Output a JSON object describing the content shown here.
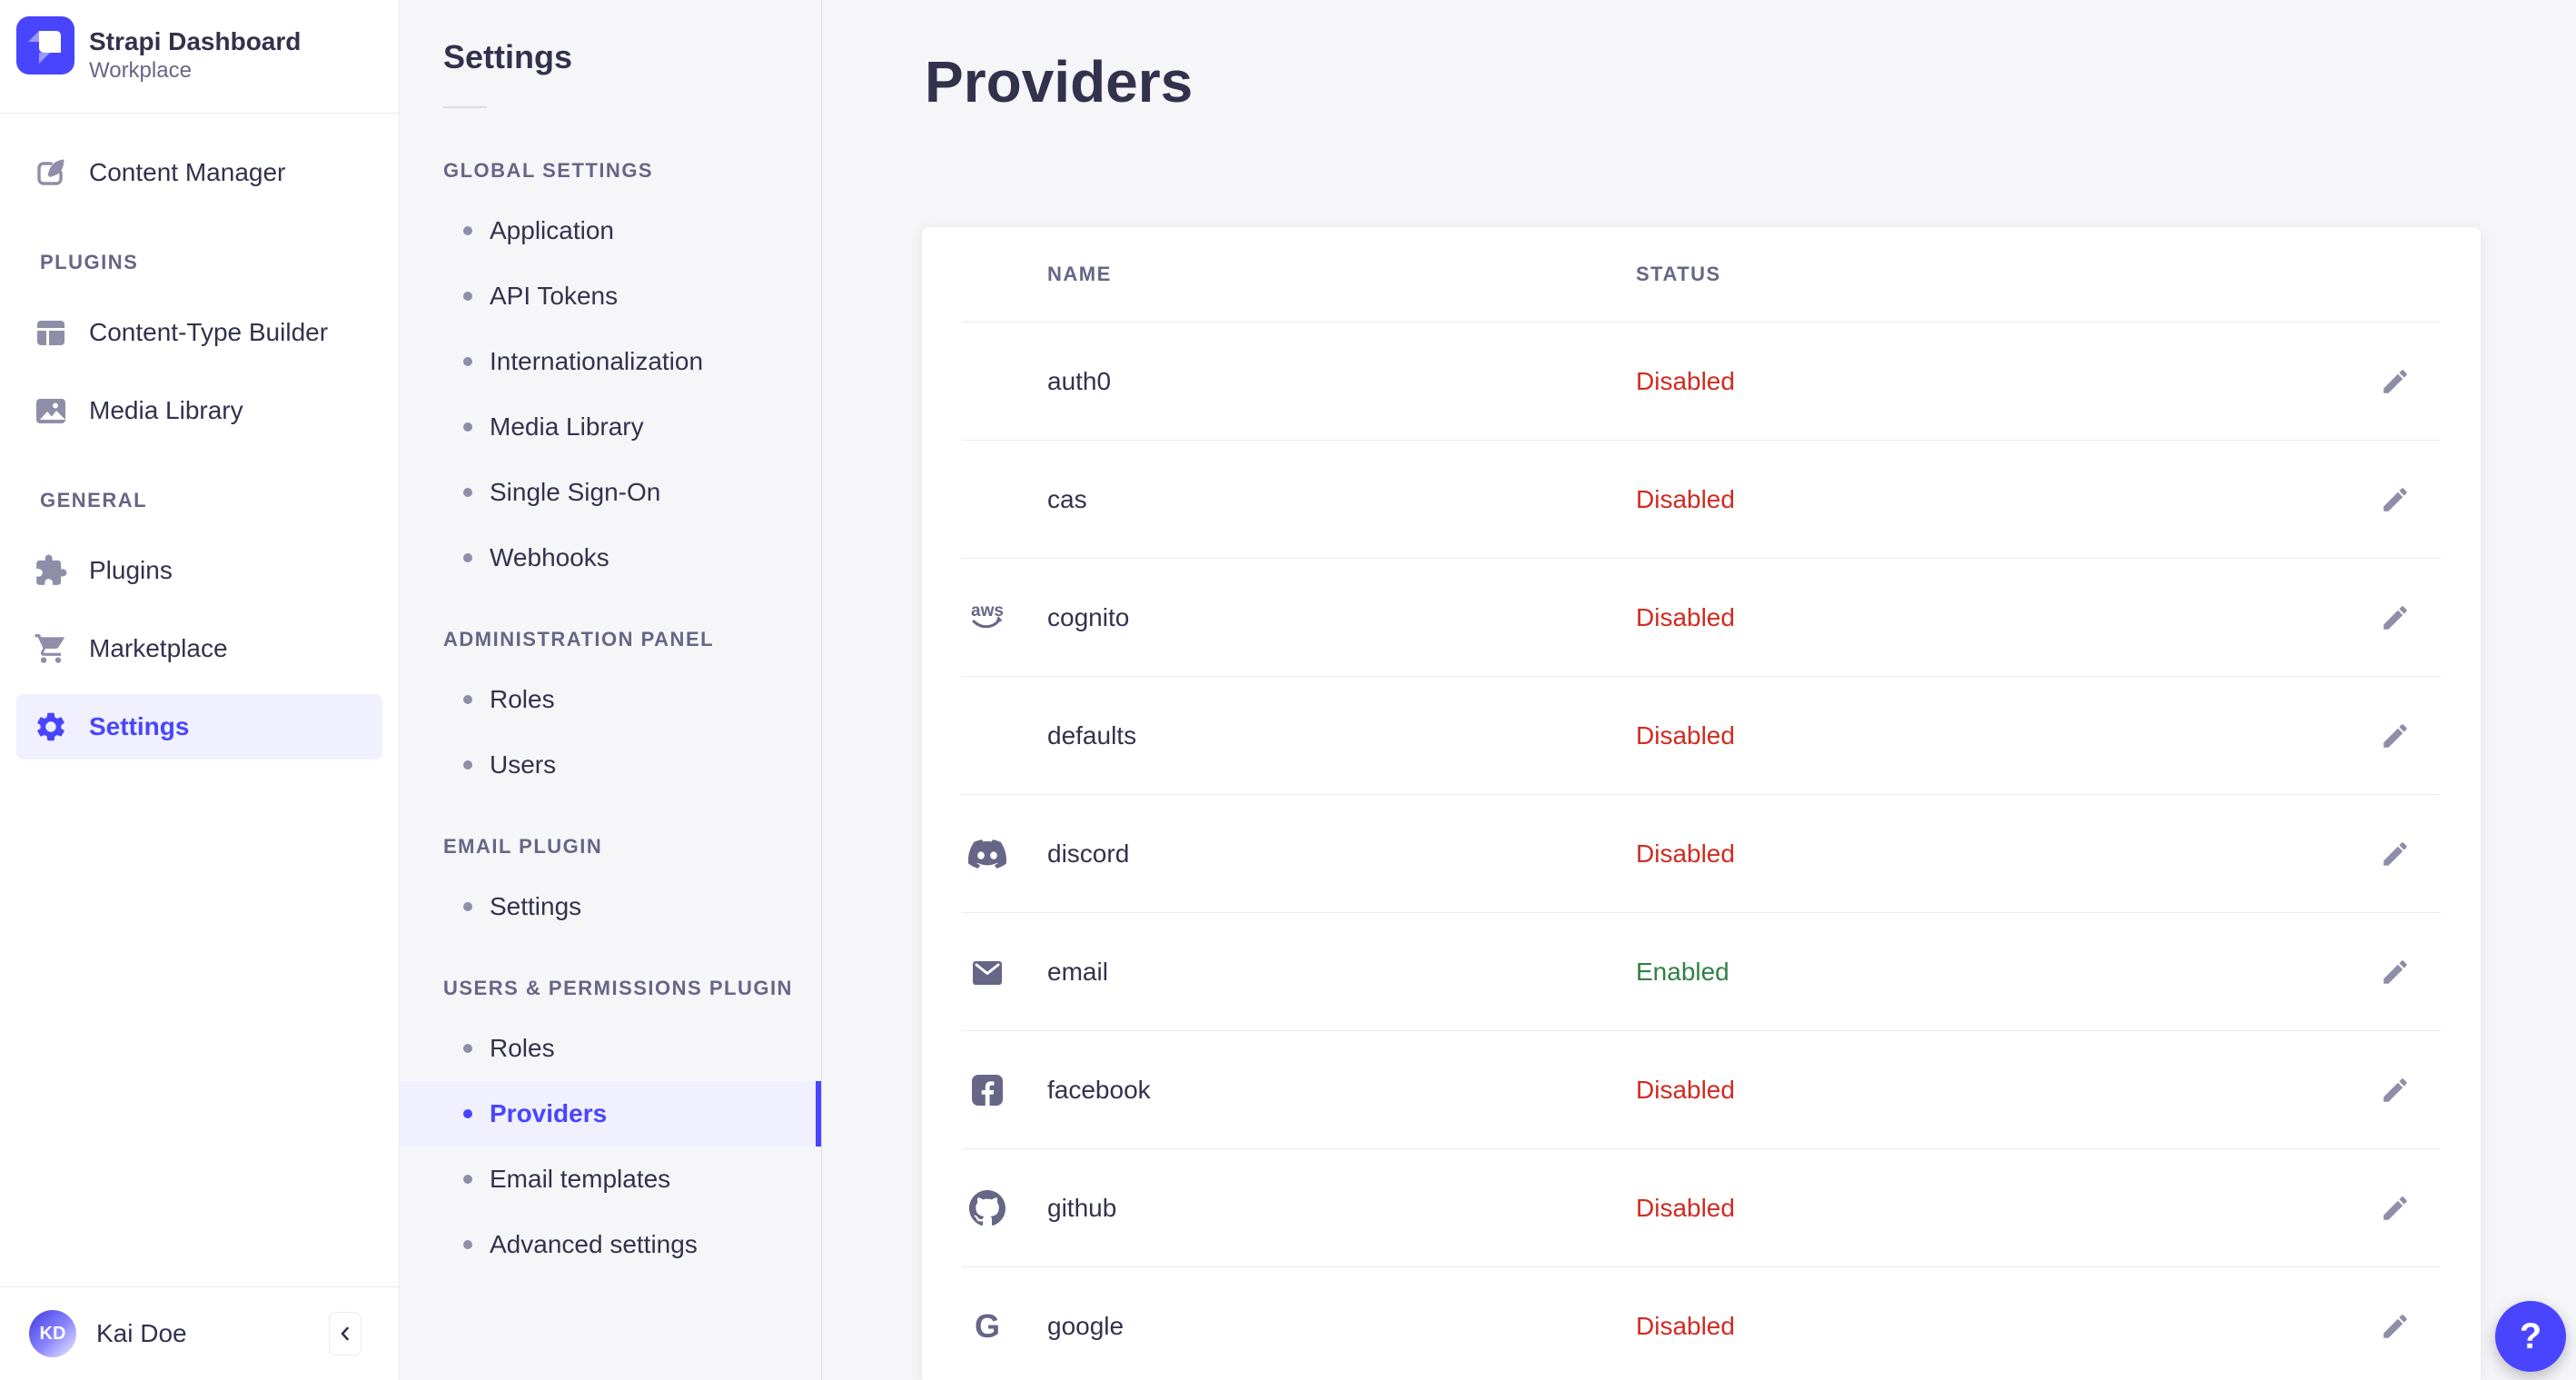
{
  "colors": {
    "accent": "#4945ff",
    "accent_bg": "#f0f0ff",
    "danger": "#d02b20",
    "success": "#328048",
    "page_bg": "#f6f6f9"
  },
  "main_sidebar": {
    "app_name": "Strapi Dashboard",
    "workspace": "Workplace",
    "content_manager": {
      "label": "Content Manager",
      "icon": "content-manager-icon"
    },
    "sections": [
      {
        "title": "PLUGINS",
        "items": [
          {
            "label": "Content-Type Builder",
            "icon": "content-type-builder-icon"
          },
          {
            "label": "Media Library",
            "icon": "media-library-icon"
          }
        ]
      },
      {
        "title": "GENERAL",
        "items": [
          {
            "label": "Plugins",
            "icon": "puzzle-icon"
          },
          {
            "label": "Marketplace",
            "icon": "cart-icon"
          },
          {
            "label": "Settings",
            "icon": "gear-icon",
            "active": true
          }
        ]
      }
    ],
    "user": {
      "initials": "KD",
      "name": "Kai Doe"
    }
  },
  "settings_nav": {
    "title": "Settings",
    "sections": [
      {
        "title": "GLOBAL SETTINGS",
        "items": [
          "Application",
          "API Tokens",
          "Internationalization",
          "Media Library",
          "Single Sign-On",
          "Webhooks"
        ]
      },
      {
        "title": "ADMINISTRATION PANEL",
        "items": [
          "Roles",
          "Users"
        ]
      },
      {
        "title": "EMAIL PLUGIN",
        "items": [
          "Settings"
        ]
      },
      {
        "title": "USERS & PERMISSIONS PLUGIN",
        "items": [
          "Roles",
          "Providers",
          "Email templates",
          "Advanced settings"
        ],
        "active_item": "Providers"
      }
    ]
  },
  "content": {
    "title": "Providers",
    "table": {
      "columns": [
        "NAME",
        "STATUS"
      ],
      "rows": [
        {
          "name": "auth0",
          "icon": null,
          "status": "Disabled"
        },
        {
          "name": "cas",
          "icon": null,
          "status": "Disabled"
        },
        {
          "name": "cognito",
          "icon": "aws-icon",
          "status": "Disabled"
        },
        {
          "name": "defaults",
          "icon": null,
          "status": "Disabled"
        },
        {
          "name": "discord",
          "icon": "discord-icon",
          "status": "Disabled"
        },
        {
          "name": "email",
          "icon": "envelope-icon",
          "status": "Enabled"
        },
        {
          "name": "facebook",
          "icon": "facebook-icon",
          "status": "Disabled"
        },
        {
          "name": "github",
          "icon": "github-icon",
          "status": "Disabled"
        },
        {
          "name": "google",
          "icon": "google-icon",
          "status": "Disabled"
        }
      ]
    }
  },
  "help": {
    "label": "?"
  }
}
